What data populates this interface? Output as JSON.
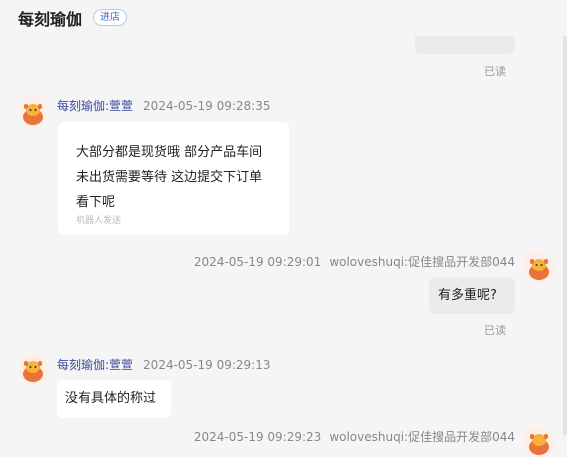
{
  "header": {
    "shop_name": "每刻瑜伽",
    "enter_label": "进店"
  },
  "messages": [
    {
      "read_label": "已读"
    },
    {
      "sender": "每刻瑜伽:萱萱",
      "time": "2024-05-19 09:28:35",
      "lines": [
        "大部分都是现货哦 部分产品车间",
        "未出货需要等待 这边提交下订单",
        "看下呢"
      ],
      "note": "机器人发送"
    },
    {
      "sender": "woloveshuqi:促佳搜品开发部044",
      "time": "2024-05-19 09:29:01",
      "text": "有多重呢?",
      "read_label": "已读"
    },
    {
      "sender": "每刻瑜伽:萱萱",
      "time": "2024-05-19 09:29:13",
      "text": "没有具体的称过"
    },
    {
      "sender": "woloveshuqi:促佳搜品开发部044",
      "time": "2024-05-19 09:29:23"
    }
  ]
}
